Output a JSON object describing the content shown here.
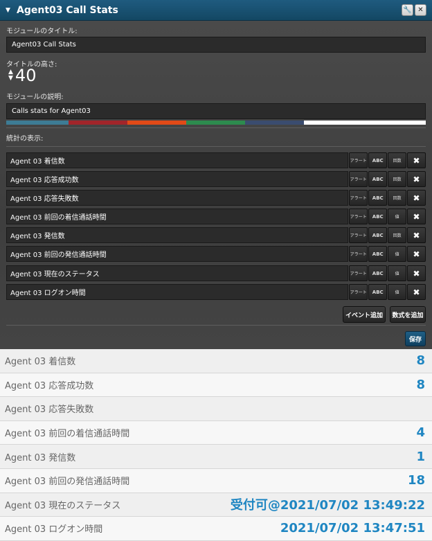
{
  "window": {
    "title": "Agent03 Call Stats",
    "toggle_icon": "▼",
    "wrench_icon": "🔧",
    "close_icon": "✕"
  },
  "editor": {
    "title_label": "モジュールのタイトル:",
    "title_value": "Agent03 Call Stats",
    "height_label": "タイトルの高さ:",
    "height_value": "40",
    "desc_label": "モジュールの説明:",
    "desc_value": "Calls stats for Agent03",
    "stats_label": "統計の表示:",
    "color_swatches": [
      "#3d7c95",
      "#a1252a",
      "#e24a17",
      "#2d8b4e",
      "#3a4c6f",
      "#ffffff"
    ],
    "rows": [
      {
        "name": "Agent 03 着信数",
        "alert": "アラート",
        "abc": "ABC",
        "type": "回数",
        "delete": "✖"
      },
      {
        "name": "Agent 03 応答成功数",
        "alert": "アラート",
        "abc": "ABC",
        "type": "回数",
        "delete": "✖"
      },
      {
        "name": "Agent 03 応答失敗数",
        "alert": "アラート",
        "abc": "ABC",
        "type": "回数",
        "delete": "✖"
      },
      {
        "name": "Agent 03 前回の着信通話時間",
        "alert": "アラート",
        "abc": "ABC",
        "type": "値",
        "delete": "✖"
      },
      {
        "name": "Agent 03 発信数",
        "alert": "アラート",
        "abc": "ABC",
        "type": "回数",
        "delete": "✖"
      },
      {
        "name": "Agent 03 前回の発信通話時間",
        "alert": "アラート",
        "abc": "ABC",
        "type": "値",
        "delete": "✖"
      },
      {
        "name": "Agent 03 現在のステータス",
        "alert": "アラート",
        "abc": "ABC",
        "type": "値",
        "delete": "✖"
      },
      {
        "name": "Agent 03 ログオン時間",
        "alert": "アラート",
        "abc": "ABC",
        "type": "値",
        "delete": "✖"
      }
    ],
    "add_event_label": "イベント追加",
    "add_formula_label": "数式を追加",
    "save_label": "保存"
  },
  "stats": [
    {
      "name": "Agent 03 着信数",
      "value": "8"
    },
    {
      "name": "Agent 03 応答成功数",
      "value": "8"
    },
    {
      "name": "Agent 03 応答失敗数",
      "value": ""
    },
    {
      "name": "Agent 03 前回の着信通話時間",
      "value": "4"
    },
    {
      "name": "Agent 03 発信数",
      "value": "1"
    },
    {
      "name": "Agent 03 前回の発信通話時間",
      "value": "18"
    },
    {
      "name": "Agent 03 現在のステータス",
      "value": "受付可@2021/07/02 13:49:22"
    },
    {
      "name": "Agent 03 ログオン時間",
      "value": "2021/07/02 13:47:51"
    }
  ]
}
